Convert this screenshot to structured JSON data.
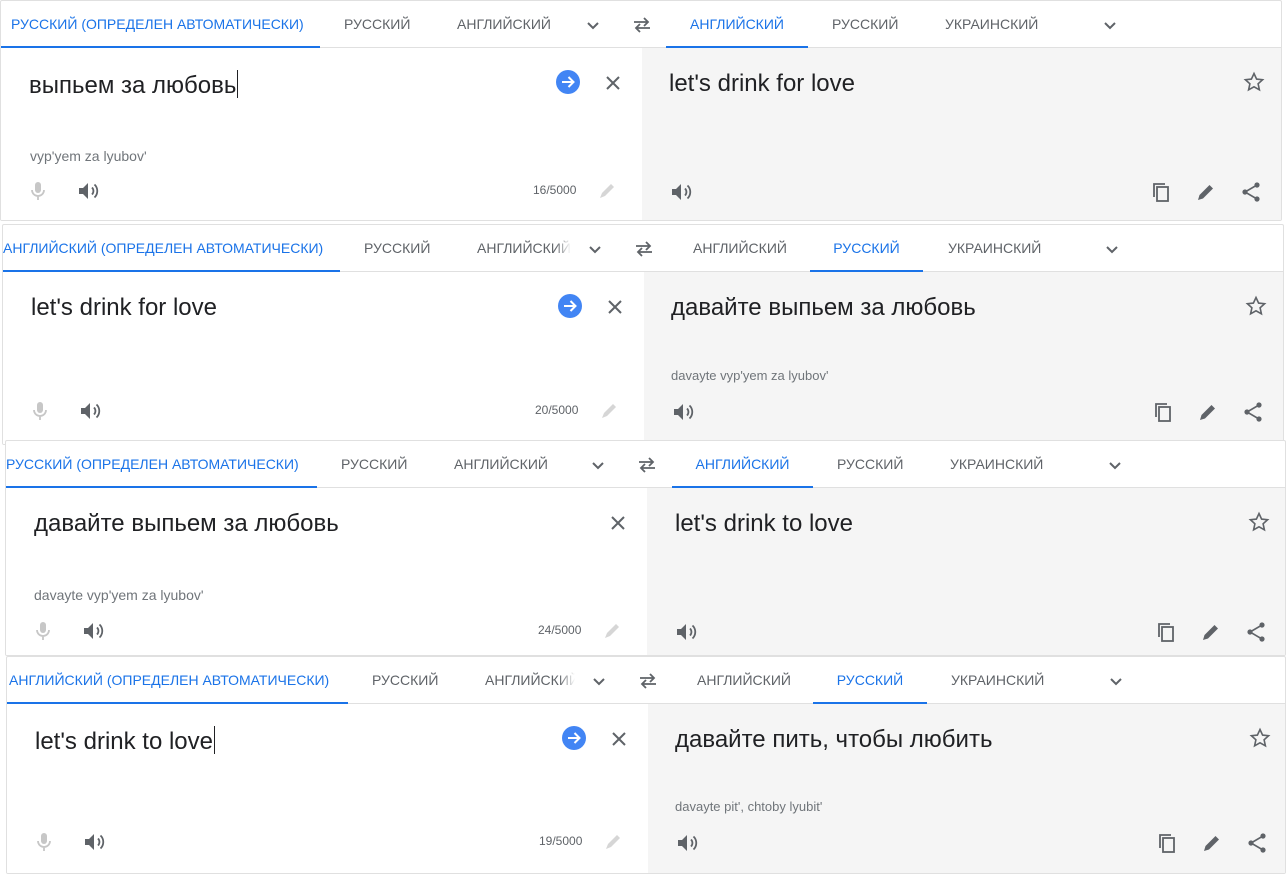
{
  "colors": {
    "accent": "#1a73e8",
    "go_button": "#4285f4",
    "target_bg": "#f5f5f5"
  },
  "panels": [
    {
      "source_tabs": [
        "РУССКИЙ (ОПРЕДЕЛЕН АВТОМАТИЧЕСКИ)",
        "РУССКИЙ",
        "АНГЛИЙСКИЙ"
      ],
      "target_tabs": [
        "АНГЛИЙСКИЙ",
        "РУССКИЙ",
        "УКРАИНСКИЙ"
      ],
      "source_active": 0,
      "target_active": 0,
      "source_text": "выпьем за любовь",
      "source_translit": "vyp'yem za lyubov'",
      "counter": "16/5000",
      "target_text": "let's drink for love",
      "target_translit": "",
      "show_go": true,
      "show_caret": true
    },
    {
      "source_tabs": [
        "АНГЛИЙСКИЙ (ОПРЕДЕЛЕН АВТОМАТИЧЕСКИ)",
        "РУССКИЙ",
        "АНГЛИЙСКИЙ"
      ],
      "target_tabs": [
        "АНГЛИЙСКИЙ",
        "РУССКИЙ",
        "УКРАИНСКИЙ"
      ],
      "source_active": 0,
      "target_active": 1,
      "source_text": "let's drink for love",
      "source_translit": "",
      "counter": "20/5000",
      "target_text": "давайте выпьем за любовь",
      "target_translit": "davayte vyp'yem za lyubov'",
      "show_go": true,
      "show_caret": false
    },
    {
      "source_tabs": [
        "РУССКИЙ (ОПРЕДЕЛЕН АВТОМАТИЧЕСКИ)",
        "РУССКИЙ",
        "АНГЛИЙСКИЙ"
      ],
      "target_tabs": [
        "АНГЛИЙСКИЙ",
        "РУССКИЙ",
        "УКРАИНСКИЙ"
      ],
      "source_active": 0,
      "target_active": 0,
      "source_text": "давайте выпьем за любовь",
      "source_translit": "davayte vyp'yem za lyubov'",
      "counter": "24/5000",
      "target_text": "let's drink to love",
      "target_translit": "",
      "show_go": false,
      "show_caret": false
    },
    {
      "source_tabs": [
        "АНГЛИЙСКИЙ (ОПРЕДЕЛЕН АВТОМАТИЧЕСКИ)",
        "РУССКИЙ",
        "АНГЛИЙСКИЙ"
      ],
      "target_tabs": [
        "АНГЛИЙСКИЙ",
        "РУССКИЙ",
        "УКРАИНСКИЙ"
      ],
      "source_active": 0,
      "target_active": 1,
      "source_text": "let's drink to love",
      "source_translit": "",
      "counter": "19/5000",
      "target_text": "давайте пить, чтобы любить",
      "target_translit": "davayte pit', chtoby lyubit'",
      "show_go": true,
      "show_caret": true
    }
  ]
}
